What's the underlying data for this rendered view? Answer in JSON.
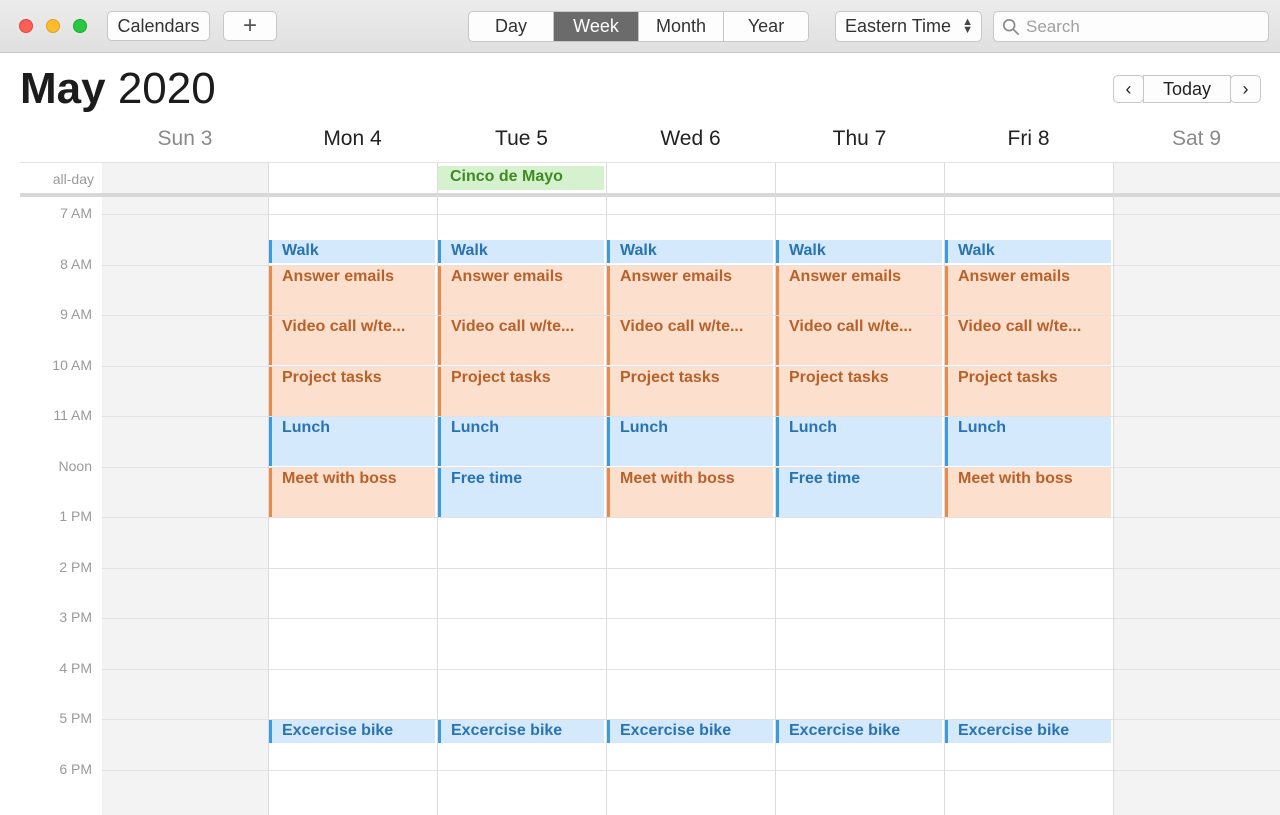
{
  "toolbar": {
    "calendars_label": "Calendars",
    "add_label": "+",
    "views": [
      {
        "label": "Day",
        "active": false
      },
      {
        "label": "Week",
        "active": true
      },
      {
        "label": "Month",
        "active": false
      },
      {
        "label": "Year",
        "active": false
      }
    ],
    "timezone": "Eastern Time",
    "search_placeholder": "Search"
  },
  "header": {
    "month": "May",
    "year": "2020",
    "today_label": "Today",
    "prev_label": "‹",
    "next_label": "›"
  },
  "days": [
    {
      "label": "Sun 3",
      "weekend": true
    },
    {
      "label": "Mon 4",
      "weekend": false
    },
    {
      "label": "Tue 5",
      "weekend": false
    },
    {
      "label": "Wed 6",
      "weekend": false
    },
    {
      "label": "Thu 7",
      "weekend": false
    },
    {
      "label": "Fri 8",
      "weekend": false
    },
    {
      "label": "Sat 9",
      "weekend": true
    }
  ],
  "allday_label": "all-day",
  "hours": [
    "7 AM",
    "8 AM",
    "9 AM",
    "10 AM",
    "11 AM",
    "Noon",
    "1 PM",
    "2 PM",
    "3 PM",
    "4 PM",
    "5 PM",
    "6 PM"
  ],
  "allday_events": [
    {
      "day": 2,
      "title": "Cinco de Mayo",
      "color": "#3f8a25"
    }
  ],
  "events": [
    {
      "day": 1,
      "start": 7.5,
      "end": 8.0,
      "title": "Walk",
      "color": "blue"
    },
    {
      "day": 2,
      "start": 7.5,
      "end": 8.0,
      "title": "Walk",
      "color": "blue"
    },
    {
      "day": 3,
      "start": 7.5,
      "end": 8.0,
      "title": "Walk",
      "color": "blue"
    },
    {
      "day": 4,
      "start": 7.5,
      "end": 8.0,
      "title": "Walk",
      "color": "blue"
    },
    {
      "day": 5,
      "start": 7.5,
      "end": 8.0,
      "title": "Walk",
      "color": "blue"
    },
    {
      "day": 1,
      "start": 8,
      "end": 9,
      "title": "Answer emails",
      "color": "orange"
    },
    {
      "day": 2,
      "start": 8,
      "end": 9,
      "title": "Answer emails",
      "color": "orange"
    },
    {
      "day": 3,
      "start": 8,
      "end": 9,
      "title": "Answer emails",
      "color": "orange"
    },
    {
      "day": 4,
      "start": 8,
      "end": 9,
      "title": "Answer emails",
      "color": "orange"
    },
    {
      "day": 5,
      "start": 8,
      "end": 9,
      "title": "Answer emails",
      "color": "orange"
    },
    {
      "day": 1,
      "start": 9,
      "end": 10,
      "title": "Video call w/te...",
      "color": "orange"
    },
    {
      "day": 2,
      "start": 9,
      "end": 10,
      "title": "Video call w/te...",
      "color": "orange"
    },
    {
      "day": 3,
      "start": 9,
      "end": 10,
      "title": "Video call w/te...",
      "color": "orange"
    },
    {
      "day": 4,
      "start": 9,
      "end": 10,
      "title": "Video call w/te...",
      "color": "orange"
    },
    {
      "day": 5,
      "start": 9,
      "end": 10,
      "title": "Video call w/te...",
      "color": "orange"
    },
    {
      "day": 1,
      "start": 10,
      "end": 11,
      "title": "Project tasks",
      "color": "orange"
    },
    {
      "day": 2,
      "start": 10,
      "end": 11,
      "title": "Project tasks",
      "color": "orange"
    },
    {
      "day": 3,
      "start": 10,
      "end": 11,
      "title": "Project tasks",
      "color": "orange"
    },
    {
      "day": 4,
      "start": 10,
      "end": 11,
      "title": "Project tasks",
      "color": "orange"
    },
    {
      "day": 5,
      "start": 10,
      "end": 11,
      "title": "Project tasks",
      "color": "orange"
    },
    {
      "day": 1,
      "start": 11,
      "end": 12,
      "title": "Lunch",
      "color": "blue"
    },
    {
      "day": 2,
      "start": 11,
      "end": 12,
      "title": "Lunch",
      "color": "blue"
    },
    {
      "day": 3,
      "start": 11,
      "end": 12,
      "title": "Lunch",
      "color": "blue"
    },
    {
      "day": 4,
      "start": 11,
      "end": 12,
      "title": "Lunch",
      "color": "blue"
    },
    {
      "day": 5,
      "start": 11,
      "end": 12,
      "title": "Lunch",
      "color": "blue"
    },
    {
      "day": 1,
      "start": 12,
      "end": 13,
      "title": "Meet with boss",
      "color": "orange"
    },
    {
      "day": 2,
      "start": 12,
      "end": 13,
      "title": "Free time",
      "color": "blue"
    },
    {
      "day": 3,
      "start": 12,
      "end": 13,
      "title": "Meet with boss",
      "color": "orange"
    },
    {
      "day": 4,
      "start": 12,
      "end": 13,
      "title": "Free time",
      "color": "blue"
    },
    {
      "day": 5,
      "start": 12,
      "end": 13,
      "title": "Meet with boss",
      "color": "orange"
    },
    {
      "day": 1,
      "start": 17,
      "end": 17.5,
      "title": "Excercise bike",
      "color": "blue"
    },
    {
      "day": 2,
      "start": 17,
      "end": 17.5,
      "title": "Excercise bike",
      "color": "blue"
    },
    {
      "day": 3,
      "start": 17,
      "end": 17.5,
      "title": "Excercise bike",
      "color": "blue"
    },
    {
      "day": 4,
      "start": 17,
      "end": 17.5,
      "title": "Excercise bike",
      "color": "blue"
    },
    {
      "day": 5,
      "start": 17,
      "end": 17.5,
      "title": "Excercise bike",
      "color": "blue"
    }
  ],
  "colors": {
    "blue_fill": "#d4e9fb",
    "blue_text": "#2a73b3",
    "orange_fill": "#fcdfcd",
    "orange_text": "#b8612a",
    "holiday_fill": "#d6f1cd",
    "holiday_text": "#3f8a25"
  }
}
